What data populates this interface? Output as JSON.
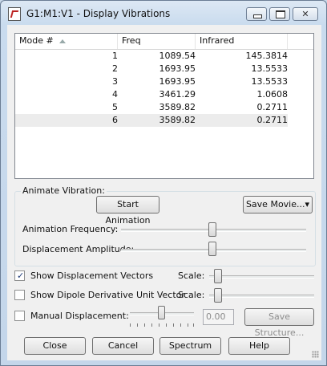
{
  "window": {
    "title": "G1:M1:V1 - Display Vibrations",
    "controls": [
      "minimize",
      "maximize",
      "close"
    ]
  },
  "table": {
    "columns": [
      "Mode #",
      "Freq",
      "Infrared"
    ],
    "rows": [
      [
        "1",
        "1089.54",
        "145.3814"
      ],
      [
        "2",
        "1693.95",
        "13.5533"
      ],
      [
        "3",
        "1693.95",
        "13.5533"
      ],
      [
        "4",
        "3461.29",
        "1.0608"
      ],
      [
        "5",
        "3589.82",
        "0.2711"
      ],
      [
        "6",
        "3589.82",
        "0.2711"
      ]
    ]
  },
  "animate": {
    "group_label": "Animate Vibration:",
    "start_button": "Start Animation",
    "save_movie_button": "Save Movie...",
    "frequency_label": "Animation Frequency:",
    "amplitude_label": "Displacement Amplitude:",
    "frequency_level": 0.5,
    "amplitude_level": 0.5
  },
  "options": {
    "show_vectors_label": "Show Displacement Vectors",
    "show_vectors_checked": true,
    "show_dipole_label": "Show Dipole Derivative Unit Vector",
    "show_dipole_checked": false,
    "scale_label": "Scale:",
    "scale1_level": 0.05,
    "scale2_level": 0.05,
    "manual_label": "Manual Displacement:",
    "manual_checked": false,
    "manual_value": "0.00",
    "save_structure_button": "Save Structure...",
    "manual_level": 0.5
  },
  "footer": {
    "close": "Close",
    "cancel": "Cancel",
    "spectrum": "Spectrum",
    "help": "Help"
  },
  "icons": {
    "window_icon": "document-icon"
  }
}
